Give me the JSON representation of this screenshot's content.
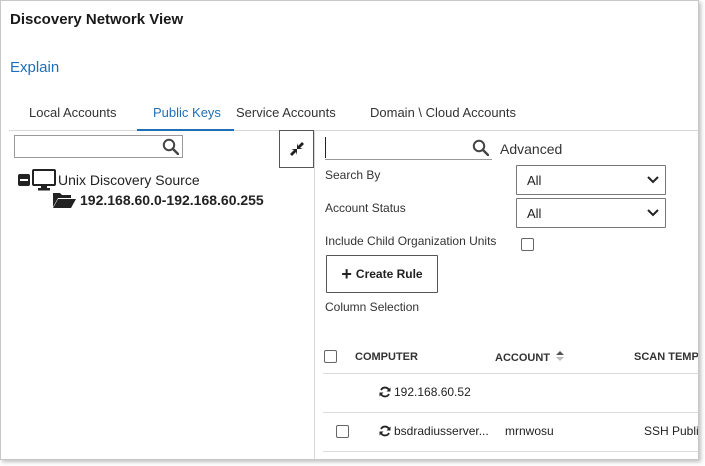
{
  "page": {
    "title": "Discovery Network View",
    "explain_link": "Explain"
  },
  "tabs": [
    {
      "label": "Local Accounts",
      "active": false
    },
    {
      "label": "Public Keys",
      "active": true
    },
    {
      "label": "Service Accounts",
      "active": false
    },
    {
      "label": "Domain \\ Cloud Accounts",
      "active": false
    }
  ],
  "tree": {
    "search_value": "",
    "nodes": [
      {
        "label": "Unix Discovery Source",
        "icon": "monitor-icon",
        "expanded": true
      },
      {
        "label": "192.168.60.0-192.168.60.255",
        "icon": "open-folder-icon"
      }
    ]
  },
  "search": {
    "value": "",
    "advanced_label": "Advanced"
  },
  "filters": {
    "search_by": {
      "label": "Search By",
      "value": "All"
    },
    "account_status": {
      "label": "Account Status",
      "value": "All"
    },
    "include_child": {
      "label": "Include Child Organization Units",
      "checked": false
    }
  },
  "actions": {
    "create_rule": "Create Rule",
    "column_selection": "Column Selection"
  },
  "table": {
    "columns": [
      "COMPUTER",
      "ACCOUNT",
      "SCAN TEMPLATE"
    ],
    "sorted_column": "ACCOUNT",
    "rows": [
      {
        "computer": "192.168.60.52",
        "account": "",
        "scan_template": "",
        "has_checkbox": false
      },
      {
        "computer": "bsdradiusserver...",
        "account": "mrnwosu",
        "scan_template": "SSH Public Key",
        "has_checkbox": true
      }
    ]
  },
  "colors": {
    "accent": "#1f6fb8",
    "border": "#d8d8d8"
  }
}
